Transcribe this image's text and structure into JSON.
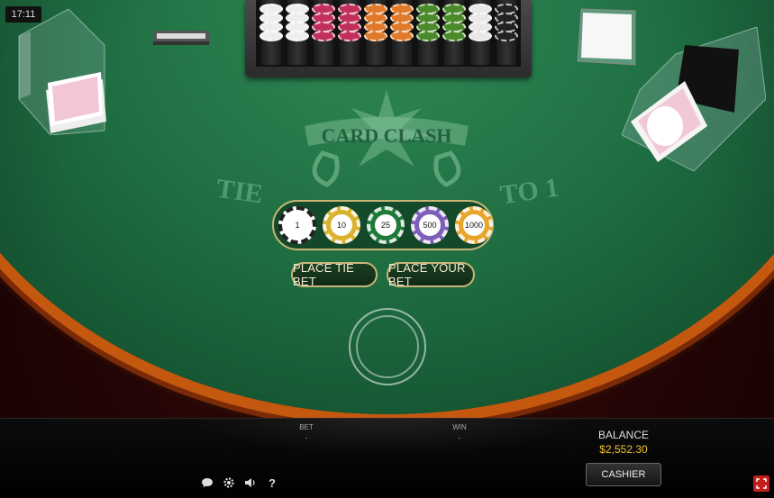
{
  "clock": "17:11",
  "table": {
    "logo_text": "CARD CLASH",
    "pays_left": "TIE",
    "pays_right": "TO 1"
  },
  "chips": [
    {
      "value": "1",
      "color": "#ffffff"
    },
    {
      "value": "10",
      "color": "#d9b22e"
    },
    {
      "value": "25",
      "color": "#1f7a3a"
    },
    {
      "value": "500",
      "color": "#7d5fb8"
    },
    {
      "value": "1000",
      "color": "#e8a52b"
    }
  ],
  "buttons": {
    "place_tie_bet": "PLACE TIE BET",
    "place_your_bet": "PLACE YOUR BET"
  },
  "bottom_bar": {
    "bet_label": "BET",
    "bet_value": "-",
    "win_label": "WIN",
    "win_value": "-",
    "balance_label": "BALANCE",
    "balance_value": "$2,552.30",
    "cashier_label": "CASHIER"
  },
  "icons": [
    "chat-icon",
    "settings-icon",
    "sound-icon",
    "help-icon",
    "fullscreen-icon"
  ],
  "colors": {
    "accent_gold": "#c6b777",
    "balance_yellow": "#f1c232",
    "felt_green": "#1f6e42",
    "fullscreen_red": "#c0201b"
  }
}
